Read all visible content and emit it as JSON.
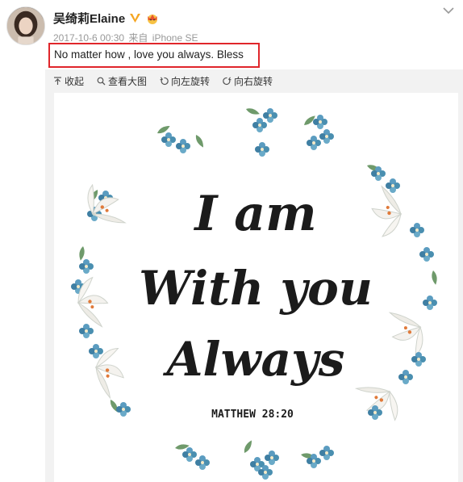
{
  "user": {
    "name": "吴绮莉Elaine",
    "verified_icon": "verified-v-icon",
    "badge_icon": "crown-badge-icon"
  },
  "meta": {
    "date": "2017-10-6 00:30",
    "source_prefix": "来自",
    "source": "iPhone SE"
  },
  "post": {
    "text": "No matter how , love you always. Bless"
  },
  "toolbar": {
    "collapse": "收起",
    "view_large": "查看大图",
    "rotate_left": "向左旋转",
    "rotate_right": "向右旋转"
  },
  "image": {
    "line1": "I am",
    "line2": "With you",
    "line3": "Always",
    "reference": "MATTHEW 28:20"
  },
  "colors": {
    "highlight_border": "#e0262b",
    "verified": "#f5a623",
    "flower_blue": "#4a8fb0",
    "leaf_green": "#6f9a6b"
  }
}
